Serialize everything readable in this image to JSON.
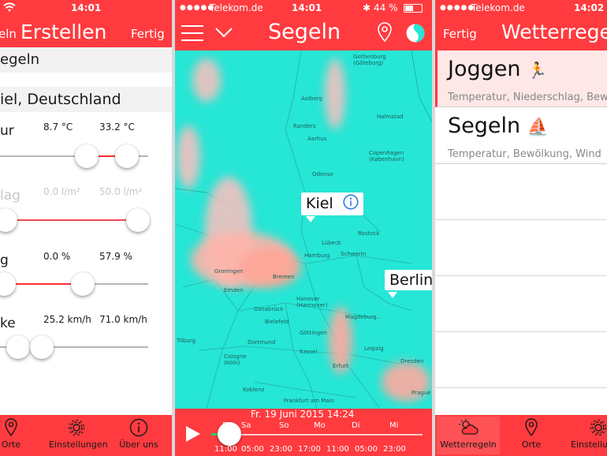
{
  "colors": {
    "accent": "#ff3b3f",
    "map_water": "#26e6d6",
    "text_dark": "#1a1a1a"
  },
  "screen1": {
    "status": {
      "time": "14:01"
    },
    "nav": {
      "back_label": "eln",
      "title": "Erstellen",
      "done_label": "Fertig"
    },
    "name_field": "egeln",
    "location_field": "iel, Deutschland",
    "rules": [
      {
        "label": "ur",
        "min": "8.7 °C",
        "max": "33.2 °C",
        "disabled": false
      },
      {
        "label": "lag",
        "min": "0.0 l/m²",
        "max": "50.0 l/m²",
        "disabled": true
      },
      {
        "label": "g",
        "min": "0.0 %",
        "max": "57.9 %",
        "disabled": false
      },
      {
        "label": "ke",
        "min": "25.2 km/h",
        "max": "71.0 km/h",
        "disabled": false
      }
    ],
    "tabs": [
      {
        "label": "Orte",
        "icon": "location-pin-icon"
      },
      {
        "label": "Einstellungen",
        "icon": "gear-icon"
      },
      {
        "label": "Über uns",
        "icon": "info-icon"
      }
    ]
  },
  "screen2": {
    "status": {
      "carrier": "Telekom.de",
      "time": "14:01",
      "battery": "44 %"
    },
    "nav": {
      "title": "Segeln",
      "menu_icon": "hamburger-menu-icon",
      "dropdown_icon": "chevron-down-icon",
      "location_icon": "location-pin-icon",
      "layer_icon": "layer-toggle-icon"
    },
    "map_labels": {
      "callout_kiel": "Kiel",
      "callout_berlin": "Berlin",
      "cities": [
        "Gothenburg (Göteborg)",
        "Aalborg",
        "Randers",
        "Aarhus",
        "Halmstad",
        "Odense",
        "Copenhagen (København)",
        "Lübeck",
        "Rostock",
        "Hamburg",
        "Schwerin",
        "Groningen",
        "Bremen",
        "Emden",
        "Hanover (Hannover)",
        "Magdeburg",
        "Osnabrück",
        "Bielefeld",
        "Tilburg",
        "Dortmund",
        "Kassel",
        "Leipzig",
        "Dresden",
        "Cologne (Köln)",
        "Erfurt",
        "Koblenz",
        "Frankfurt am Main",
        "Prague",
        "Göttingen"
      ]
    },
    "timeline": {
      "date": "Fr. 19 Juni 2015 14:24",
      "days": [
        "Fr",
        "Sa",
        "So",
        "Mo",
        "Di",
        "Mi"
      ],
      "times": [
        "11:00",
        "05:00",
        "23:00",
        "17:00",
        "11:00",
        "05:00",
        "23:00"
      ],
      "progress": 0.06
    }
  },
  "screen3": {
    "status": {
      "carrier": "Telekom.de",
      "time": "14:02"
    },
    "nav": {
      "done_label": "Fertig",
      "title": "Wetterregel"
    },
    "rules": [
      {
        "title": "Joggen",
        "emoji": "🏃",
        "subtitle": "Temperatur, Niederschlag, Bew"
      },
      {
        "title": "Segeln",
        "emoji": "⛵",
        "subtitle": "Temperatur, Bewölkung, Wind"
      }
    ],
    "tabs": [
      {
        "label": "Wetterregeln",
        "icon": "weather-icon"
      },
      {
        "label": "Orte",
        "icon": "location-pin-icon"
      },
      {
        "label": "Einstellungen",
        "icon": "gear-icon"
      }
    ]
  }
}
